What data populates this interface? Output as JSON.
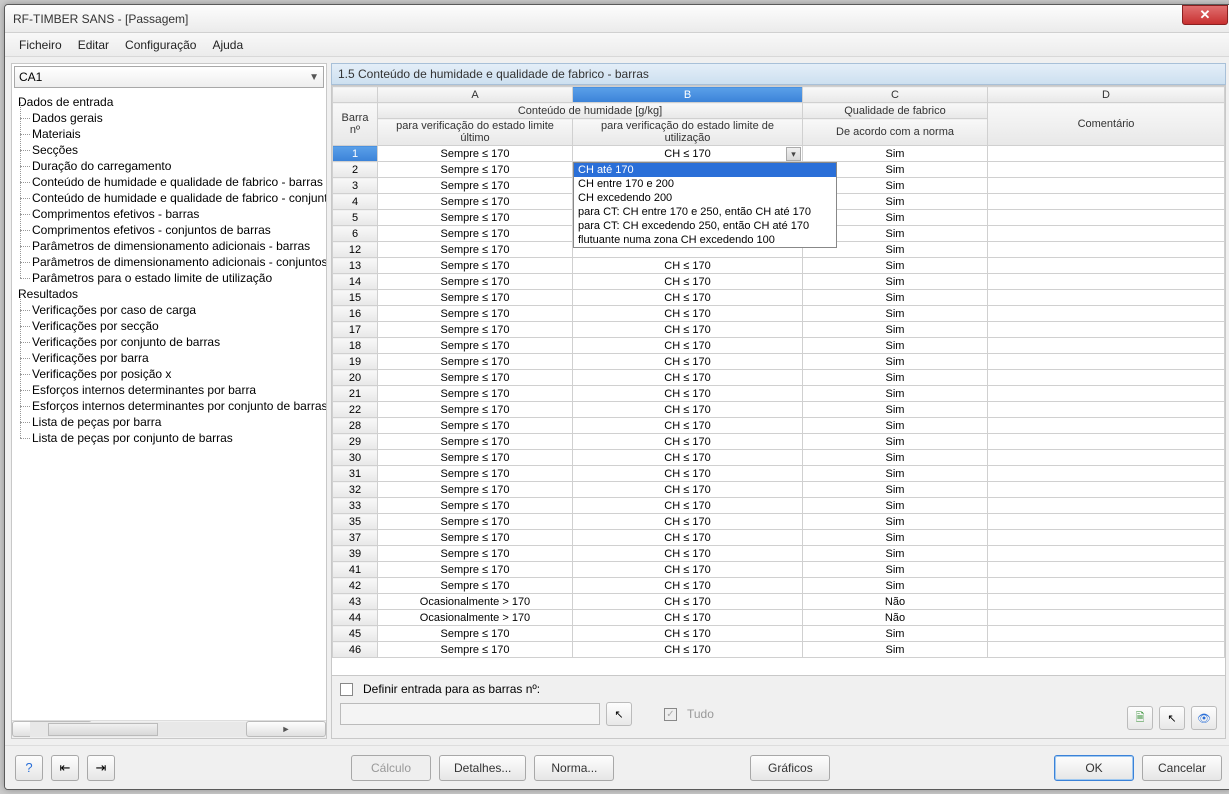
{
  "window": {
    "title": "RF-TIMBER SANS - [Passagem]"
  },
  "menu": {
    "file": "Ficheiro",
    "edit": "Editar",
    "config": "Configuração",
    "help": "Ajuda"
  },
  "combo": {
    "value": "CA1"
  },
  "tree_input_header": "Dados de entrada",
  "tree_in": [
    "Dados gerais",
    "Materiais",
    "Secções",
    "Duração do carregamento",
    "Conteúdo de humidade e qualidade de fabrico - barras",
    "Conteúdo de humidade e qualidade de fabrico - conjuntos",
    "Comprimentos efetivos - barras",
    "Comprimentos efetivos - conjuntos de barras",
    "Parâmetros de dimensionamento adicionais - barras",
    "Parâmetros de dimensionamento adicionais - conjuntos de",
    "Parâmetros para o estado limite de utilização"
  ],
  "tree_results_header": "Resultados",
  "tree_res": [
    "Verificações por caso de carga",
    "Verificações por secção",
    "Verificações por conjunto de barras",
    "Verificações por barra",
    "Verificações por posição x",
    "Esforços internos determinantes por barra",
    "Esforços internos determinantes por conjunto de barras",
    "Lista de peças por barra",
    "Lista de peças por conjunto de barras"
  ],
  "section_title": "1.5 Conteúdo de humidade e qualidade de fabrico - barras",
  "cols": {
    "rowhead1": "Barra",
    "rowhead2": "nº",
    "A": "A",
    "B": "B",
    "C": "C",
    "D": "D",
    "group_humidity": "Conteúdo de humidade [g/kg]",
    "subA": "para verificação do estado limite último",
    "subB": "para verificação do estado limite de utilização",
    "c1": "Qualidade de fabrico",
    "c2": "De acordo com a norma",
    "d": "Comentário"
  },
  "dropdown_value": "CH ≤ 170",
  "dropdown_options": [
    "CH até 170",
    "CH entre 170 e 200",
    "CH excedendo 200",
    "para CT: CH entre 170 e 250, então CH até 170",
    "para CT: CH excedendo 250, então CH até 170",
    "flutuante numa zona CH excedendo 100"
  ],
  "rows": [
    {
      "n": 1,
      "a": "Sempre ≤ 170",
      "b": "CH ≤ 170",
      "c": "Sim",
      "edit": true
    },
    {
      "n": 2,
      "a": "Sempre ≤ 170",
      "b": "",
      "c": "Sim"
    },
    {
      "n": 3,
      "a": "Sempre ≤ 170",
      "b": "",
      "c": "Sim"
    },
    {
      "n": 4,
      "a": "Sempre ≤ 170",
      "b": "",
      "c": "Sim"
    },
    {
      "n": 5,
      "a": "Sempre ≤ 170",
      "b": "",
      "c": "Sim"
    },
    {
      "n": 6,
      "a": "Sempre ≤ 170",
      "b": "",
      "c": "Sim"
    },
    {
      "n": 12,
      "a": "Sempre ≤ 170",
      "b": "",
      "c": "Sim"
    },
    {
      "n": 13,
      "a": "Sempre ≤ 170",
      "b": "CH ≤ 170",
      "c": "Sim"
    },
    {
      "n": 14,
      "a": "Sempre ≤ 170",
      "b": "CH ≤ 170",
      "c": "Sim"
    },
    {
      "n": 15,
      "a": "Sempre ≤ 170",
      "b": "CH ≤ 170",
      "c": "Sim"
    },
    {
      "n": 16,
      "a": "Sempre ≤ 170",
      "b": "CH ≤ 170",
      "c": "Sim"
    },
    {
      "n": 17,
      "a": "Sempre ≤ 170",
      "b": "CH ≤ 170",
      "c": "Sim"
    },
    {
      "n": 18,
      "a": "Sempre ≤ 170",
      "b": "CH ≤ 170",
      "c": "Sim"
    },
    {
      "n": 19,
      "a": "Sempre ≤ 170",
      "b": "CH ≤ 170",
      "c": "Sim"
    },
    {
      "n": 20,
      "a": "Sempre ≤ 170",
      "b": "CH ≤ 170",
      "c": "Sim"
    },
    {
      "n": 21,
      "a": "Sempre ≤ 170",
      "b": "CH ≤ 170",
      "c": "Sim"
    },
    {
      "n": 22,
      "a": "Sempre ≤ 170",
      "b": "CH ≤ 170",
      "c": "Sim"
    },
    {
      "n": 28,
      "a": "Sempre ≤ 170",
      "b": "CH ≤ 170",
      "c": "Sim"
    },
    {
      "n": 29,
      "a": "Sempre ≤ 170",
      "b": "CH ≤ 170",
      "c": "Sim"
    },
    {
      "n": 30,
      "a": "Sempre ≤ 170",
      "b": "CH ≤ 170",
      "c": "Sim"
    },
    {
      "n": 31,
      "a": "Sempre ≤ 170",
      "b": "CH ≤ 170",
      "c": "Sim"
    },
    {
      "n": 32,
      "a": "Sempre ≤ 170",
      "b": "CH ≤ 170",
      "c": "Sim"
    },
    {
      "n": 33,
      "a": "Sempre ≤ 170",
      "b": "CH ≤ 170",
      "c": "Sim"
    },
    {
      "n": 35,
      "a": "Sempre ≤ 170",
      "b": "CH ≤ 170",
      "c": "Sim"
    },
    {
      "n": 37,
      "a": "Sempre ≤ 170",
      "b": "CH ≤ 170",
      "c": "Sim"
    },
    {
      "n": 39,
      "a": "Sempre ≤ 170",
      "b": "CH ≤ 170",
      "c": "Sim"
    },
    {
      "n": 41,
      "a": "Sempre ≤ 170",
      "b": "CH ≤ 170",
      "c": "Sim"
    },
    {
      "n": 42,
      "a": "Sempre ≤ 170",
      "b": "CH ≤ 170",
      "c": "Sim"
    },
    {
      "n": 43,
      "a": "Ocasionalmente > 170",
      "b": "CH ≤ 170",
      "c": "Não"
    },
    {
      "n": 44,
      "a": "Ocasionalmente > 170",
      "b": "CH ≤ 170",
      "c": "Não"
    },
    {
      "n": 45,
      "a": "Sempre ≤ 170",
      "b": "CH ≤ 170",
      "c": "Sim"
    },
    {
      "n": 46,
      "a": "Sempre ≤ 170",
      "b": "CH ≤ 170",
      "c": "Sim"
    }
  ],
  "options": {
    "define_label": "Definir entrada para as barras nº:",
    "tudo": "Tudo"
  },
  "buttons": {
    "calc": "Cálculo",
    "details": "Detalhes...",
    "norm": "Norma...",
    "graphics": "Gráficos",
    "ok": "OK",
    "cancel": "Cancelar"
  }
}
